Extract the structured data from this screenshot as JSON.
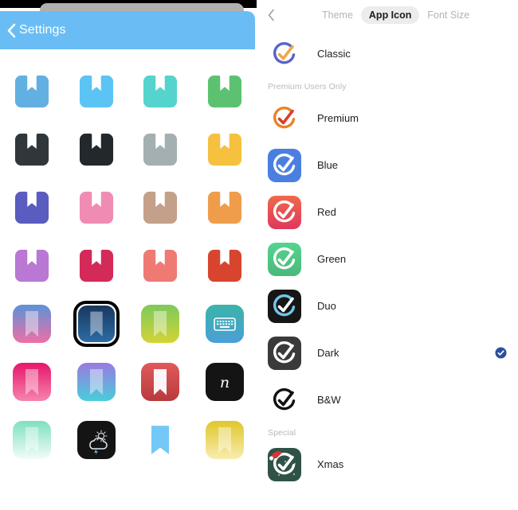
{
  "left_panel": {
    "header": {
      "back_icon": "chevron-left-icon",
      "title": "Settings",
      "background_color": "#69bdf4"
    },
    "grid": {
      "selected_index": 17,
      "rows": [
        [
          {
            "name": "bookmark-blue",
            "shape": "bookmark",
            "color": "#62b0e2"
          },
          {
            "name": "bookmark-sky",
            "shape": "bookmark",
            "color": "#5cc3f5"
          },
          {
            "name": "bookmark-teal",
            "shape": "bookmark",
            "color": "#54d4cc"
          },
          {
            "name": "bookmark-green",
            "shape": "bookmark",
            "color": "#5cc271"
          }
        ],
        [
          {
            "name": "bookmark-charcoal",
            "shape": "bookmark",
            "color": "#2f373b"
          },
          {
            "name": "bookmark-black",
            "shape": "bookmark",
            "color": "#22282b"
          },
          {
            "name": "bookmark-gray",
            "shape": "bookmark",
            "color": "#a4afb2"
          },
          {
            "name": "bookmark-yellow",
            "shape": "bookmark",
            "color": "#f5c13f"
          }
        ],
        [
          {
            "name": "bookmark-indigo",
            "shape": "bookmark",
            "color": "#5b5cc0"
          },
          {
            "name": "bookmark-pink",
            "shape": "bookmark",
            "color": "#f08cb4"
          },
          {
            "name": "bookmark-tan",
            "shape": "bookmark",
            "color": "#c4a08a"
          },
          {
            "name": "bookmark-orange",
            "shape": "bookmark",
            "color": "#ef9d4b"
          }
        ],
        [
          {
            "name": "bookmark-purple",
            "shape": "bookmark",
            "color": "#b878d3"
          },
          {
            "name": "bookmark-crimson",
            "shape": "bookmark",
            "color": "#d42a5a"
          },
          {
            "name": "bookmark-salmon",
            "shape": "bookmark",
            "color": "#ef7a73"
          },
          {
            "name": "bookmark-brick",
            "shape": "bookmark",
            "color": "#d8452f"
          }
        ],
        [
          {
            "name": "tile-blue-pink-gradient",
            "shape": "tile-bookmark",
            "color": "#5b93d8",
            "color2": "#ef6fa5"
          },
          {
            "name": "tile-navy-selected",
            "shape": "tile-bookmark",
            "color": "#17375e",
            "color2": "#2d6ca6"
          },
          {
            "name": "tile-green-lime-gradient",
            "shape": "tile-bookmark",
            "color": "#7ec95c",
            "color2": "#d3d434"
          },
          {
            "name": "tile-keyboard",
            "shape": "tile-keyboard",
            "color": "#3bb3a8",
            "color2": "#4a9fd8"
          }
        ],
        [
          {
            "name": "tile-magenta-gradient",
            "shape": "tile-bookmark",
            "color": "#e8156b",
            "color2": "#f584ae"
          },
          {
            "name": "tile-purple-cyan",
            "shape": "tile-bookmark",
            "color": "#9b7ae0",
            "color2": "#49cddb"
          },
          {
            "name": "tile-red-white-bookmark",
            "shape": "tile-bookmark-white",
            "color": "#e15a5a",
            "color2": "#b83a3e"
          },
          {
            "name": "tile-script-n",
            "shape": "tile-script",
            "color": "#141414",
            "glyph": "n"
          }
        ],
        [
          {
            "name": "tile-mint-gradient",
            "shape": "tile-bookmark",
            "color": "#7fe0c0",
            "color2": "#f2fdf8"
          },
          {
            "name": "tile-weather",
            "shape": "tile-weather",
            "color": "#141414"
          },
          {
            "name": "bookmark-lightblue",
            "shape": "bookmark-ribbon",
            "color": "#73c8f7"
          },
          {
            "name": "tile-yellow-gradient",
            "shape": "tile-bookmark",
            "color": "#e0c62c",
            "color2": "#f7edae"
          }
        ]
      ]
    }
  },
  "right_panel": {
    "back_icon": "chevron-left-icon",
    "tabs": [
      {
        "label": "Theme",
        "active": false
      },
      {
        "label": "App Icon",
        "active": true
      },
      {
        "label": "Font Size",
        "active": false
      }
    ],
    "selected_check_color": "#2b4f9e",
    "sections": [
      {
        "header": null,
        "items": [
          {
            "label": "Classic",
            "icon": "app-icon-classic",
            "bg": "#ffffff",
            "arc": "#5a63c8",
            "check": "#f0a848",
            "selected": false
          }
        ]
      },
      {
        "header": "Premium Users Only",
        "items": [
          {
            "label": "Premium",
            "icon": "app-icon-premium",
            "bg": "#ffffff",
            "arc": "#e8822a",
            "check": "#d8402e",
            "selected": false
          },
          {
            "label": "Blue",
            "icon": "app-icon-blue",
            "bg": "#4a7fe0",
            "arc": "#ffffff",
            "check": "#ffffff",
            "selected": false
          },
          {
            "label": "Red",
            "icon": "app-icon-red",
            "bg": "#ef6a4a",
            "bg2": "#e0375c",
            "arc": "#ffffff",
            "check": "#ffffff",
            "selected": false
          },
          {
            "label": "Green",
            "icon": "app-icon-green",
            "bg": "#55d48f",
            "bg2": "#4ab87a",
            "arc": "#ffffff",
            "check": "#ffffff",
            "selected": false
          },
          {
            "label": "Duo",
            "icon": "app-icon-duo",
            "bg": "#161616",
            "arc": "#6fc8e8",
            "check": "#ffffff",
            "selected": false
          },
          {
            "label": "Dark",
            "icon": "app-icon-dark",
            "bg": "#3a3a3a",
            "arc": "#ffffff",
            "check": "#ffffff",
            "selected": true
          },
          {
            "label": "B&W",
            "icon": "app-icon-bw",
            "bg": "#ffffff",
            "arc": "#111111",
            "check": "#111111",
            "selected": false
          }
        ]
      },
      {
        "header": "Special",
        "items": [
          {
            "label": "Xmas",
            "icon": "app-icon-xmas",
            "bg": "#2f5247",
            "arc": "#ffffff",
            "check": "#ffffff",
            "hat": "#d8343a",
            "selected": false
          }
        ]
      }
    ]
  }
}
